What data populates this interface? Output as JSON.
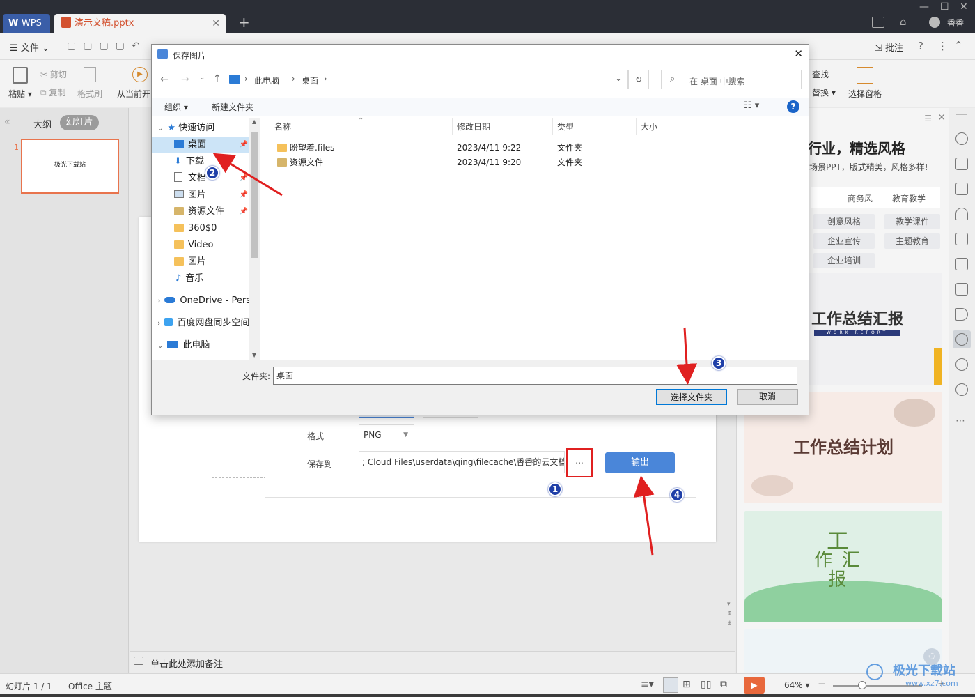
{
  "titlebar": {
    "wps_label": "WPS",
    "doc_tab": "演示文稿.pptx",
    "new_tab": "+",
    "user": "香香"
  },
  "menubar": {
    "file": "文件",
    "annotate": "批注"
  },
  "toolbar": {
    "paste": "粘贴",
    "cut": "剪切",
    "copy": "复制",
    "format_painter": "格式刷",
    "from_current": "从当前开",
    "find": "查找",
    "replace": "替换",
    "select_pane": "选择窗格"
  },
  "leftpanel": {
    "tab_outline": "大纲",
    "tab_slides": "幻灯片",
    "slide_num": "1",
    "slide_thumb_text": "极光下载站"
  },
  "notes": {
    "placeholder": "单击此处添加备注"
  },
  "status": {
    "slide_info": "幻灯片 1 / 1",
    "theme": "Office 主题",
    "zoom": "64%"
  },
  "rightpanel": {
    "heading": "行业，精选风格",
    "subheading": "场景PPT，版式精美，风格多样!",
    "chips": [
      "商务风",
      "教育教学",
      "创意风格",
      "教学课件",
      "企业宣传",
      "主题教育",
      "企业培训"
    ],
    "card1_title": "工作总结汇报",
    "card1_sub": "WORK REPORT",
    "card2_title": "工作总结计划",
    "card3_chars": [
      "工",
      "作",
      "汇",
      "报"
    ]
  },
  "export": {
    "format_label": "格式",
    "format_value": "PNG",
    "saveto_label": "保存到",
    "saveto_value": "; Cloud Files\\userdata\\qing\\filecache\\香香的云文档\\",
    "browse": "...",
    "export_button": "输出"
  },
  "dialog": {
    "title": "保存图片",
    "breadcrumb": [
      "此电脑",
      "桌面"
    ],
    "search_placeholder": "在 桌面 中搜索",
    "organize": "组织",
    "new_folder": "新建文件夹",
    "tree": [
      {
        "label": "快速访问",
        "icon": "star-icon"
      },
      {
        "label": "桌面",
        "icon": "desktop-icon",
        "pinned": true
      },
      {
        "label": "下载",
        "icon": "download-icon",
        "pinned": true
      },
      {
        "label": "文档",
        "icon": "document-icon",
        "pinned": true
      },
      {
        "label": "图片",
        "icon": "picture-icon",
        "pinned": true
      },
      {
        "label": "资源文件",
        "icon": "folder-icon",
        "pinned": true
      },
      {
        "label": "360$0",
        "icon": "folder-icon"
      },
      {
        "label": "Video",
        "icon": "folder-icon"
      },
      {
        "label": "图片",
        "icon": "folder-icon"
      },
      {
        "label": "音乐",
        "icon": "music-icon"
      },
      {
        "label": "OneDrive - Perso",
        "icon": "cloud-icon"
      },
      {
        "label": "百度网盘同步空间",
        "icon": "baidu-icon"
      },
      {
        "label": "此电脑",
        "icon": "computer-icon"
      }
    ],
    "columns": [
      "名称",
      "修改日期",
      "类型",
      "大小"
    ],
    "files": [
      {
        "name": "盼望着.files",
        "date": "2023/4/11 9:22",
        "type": "文件夹"
      },
      {
        "name": "资源文件",
        "date": "2023/4/11 9:20",
        "type": "文件夹"
      }
    ],
    "folder_label": "文件夹:",
    "folder_value": "桌面",
    "select_button": "选择文件夹",
    "cancel_button": "取消"
  },
  "annotations": [
    "1",
    "2",
    "3",
    "4"
  ],
  "watermark": {
    "text": "极光下载站",
    "url": "www.xz7.com"
  },
  "colors": {
    "accent": "#4a86d9",
    "annotation_red": "#e02020",
    "badge_blue": "#1f3fa8",
    "brand_orange": "#d35230"
  }
}
